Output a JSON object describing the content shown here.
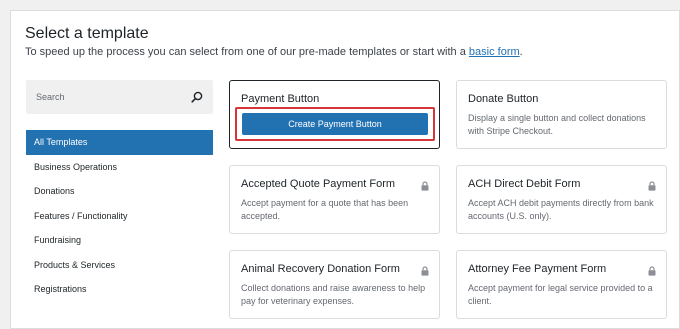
{
  "header": {
    "title": "Select a template",
    "subtitle_prefix": "To speed up the process you can select from one of our pre-made templates or start with a ",
    "subtitle_link": "basic form",
    "subtitle_suffix": "."
  },
  "search": {
    "placeholder": "Search"
  },
  "sidebar": {
    "items": [
      {
        "label": "All Templates",
        "active": true
      },
      {
        "label": "Business Operations"
      },
      {
        "label": "Donations"
      },
      {
        "label": "Features / Functionality"
      },
      {
        "label": "Fundraising"
      },
      {
        "label": "Products & Services"
      },
      {
        "label": "Registrations"
      }
    ]
  },
  "templates": [
    {
      "title": "Payment Button",
      "button_label": "Create Payment Button",
      "selected": true
    },
    {
      "title": "Donate Button",
      "description": "Display a single button and collect donations with Stripe Checkout."
    },
    {
      "title": "Accepted Quote Payment Form",
      "description": "Accept payment for a quote that has been accepted.",
      "locked": true
    },
    {
      "title": "ACH Direct Debit Form",
      "description": "Accept ACH debit payments directly from bank accounts (U.S. only).",
      "locked": true
    },
    {
      "title": "Animal Recovery Donation Form",
      "description": "Collect donations and raise awareness to help pay for veterinary expenses.",
      "locked": true
    },
    {
      "title": "Attorney Fee Payment Form",
      "description": "Accept payment for legal service provided to a client.",
      "locked": true
    }
  ],
  "colors": {
    "accent": "#2271b1",
    "highlight": "#d63638"
  }
}
